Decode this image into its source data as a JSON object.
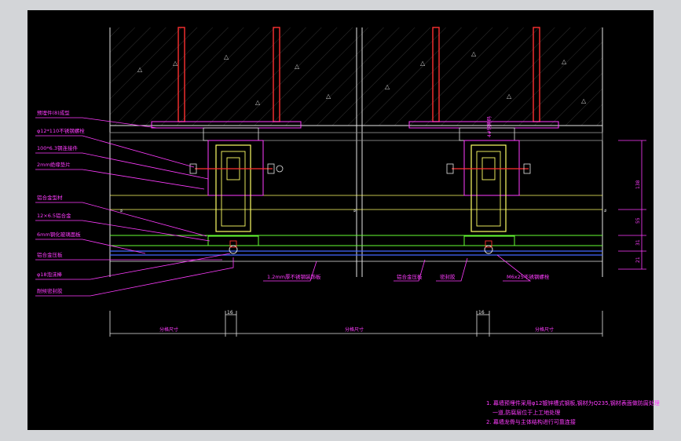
{
  "drawing": {
    "background": "#000000",
    "frame_color": "#d3d5d8",
    "colors": {
      "magenta": "#ff3cff",
      "red": "#ff3030",
      "yellow": "#ffff66",
      "green": "#66ff33",
      "blue": "#4466ff",
      "white": "#e6e6e6",
      "gray": "#b0b0b0"
    }
  },
  "left_labels": [
    "预埋件(8)成型",
    "φ12*110不锈钢螺栓",
    "100*6.3钢连接件",
    "2mm绝缘垫片",
    "铝合金型材",
    "12×6.5铝合金",
    "6mm钢化玻璃面板",
    "铝合金压板",
    "φ18泡沫棒",
    "耐候密封胶"
  ],
  "bottom_labels": {
    "left": "1.2mm厚不锈钢装饰板",
    "mid_a": "铝合金压板",
    "mid_b": "密封胶",
    "right": "M6x25不锈钢螺栓"
  },
  "dimensions": {
    "gap_left": "16",
    "gap_right": "16",
    "span_left": "分格尺寸",
    "span_mid": "分格尺寸",
    "span_right": "分格尺寸",
    "v_top": "138",
    "v_mid": "55",
    "v_low": "31",
    "v_bot": "21",
    "bracket_label": "4#钢角码"
  },
  "notes": [
    "1. 幕墙预埋件采用φ12镀锌槽式钢板,钢材为Q235,钢材表面做防腐处理",
    "一道,防腐层位于上工地处理",
    "2. 幕墙龙骨与主体结构进行可靠连接"
  ]
}
